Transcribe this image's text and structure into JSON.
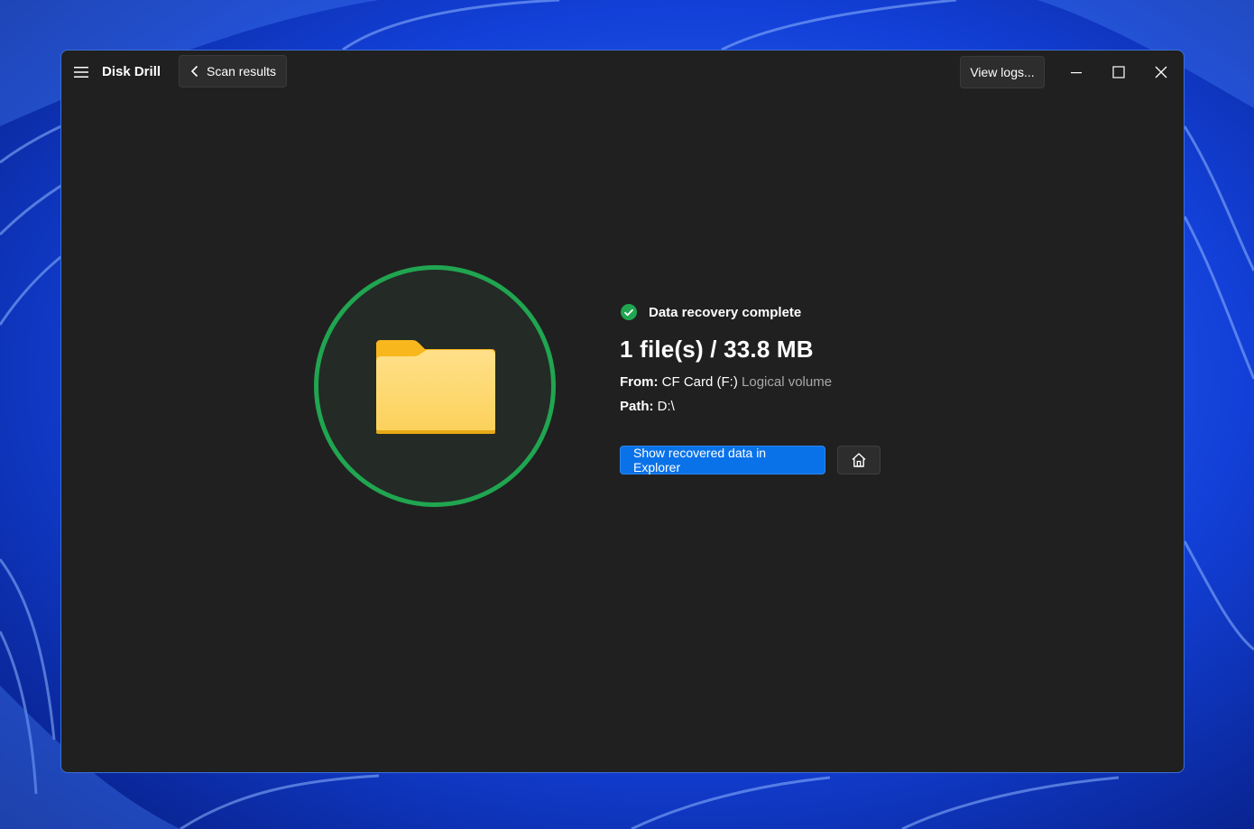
{
  "app": {
    "title": "Disk Drill"
  },
  "titlebar": {
    "back_label": "Scan results",
    "view_logs_label": "View logs..."
  },
  "result": {
    "status": "Data recovery complete",
    "summary": "1 file(s) / 33.8 MB",
    "from_label": "From:",
    "from_value": "CF Card (F:)",
    "from_type": "Logical volume",
    "path_label": "Path:",
    "path_value": "D:\\"
  },
  "actions": {
    "show_in_explorer_label": "Show recovered data in Explorer"
  },
  "icons": {
    "menu": "hamburger-icon",
    "back": "chevron-left-icon",
    "minimize": "minimize-icon",
    "maximize": "maximize-icon",
    "close": "close-icon",
    "status": "check-circle-icon",
    "folder": "folder-icon",
    "home": "home-icon"
  },
  "colors": {
    "accent": "#0a72e8",
    "success": "#20a550",
    "window_bg": "#202020",
    "folder": "#ffc83d"
  }
}
